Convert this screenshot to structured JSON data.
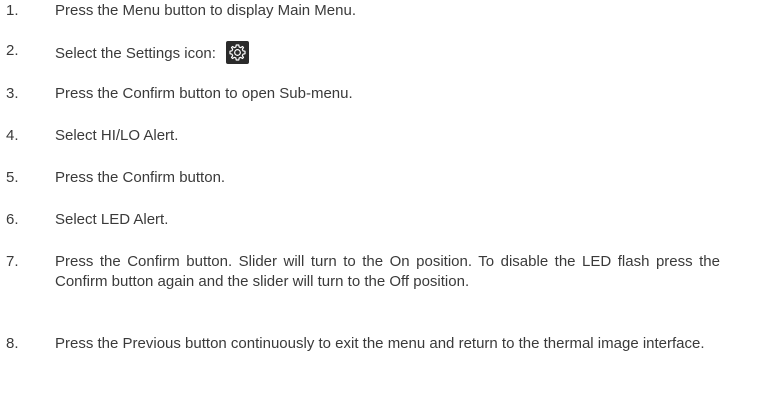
{
  "steps": [
    {
      "number": "1.",
      "text": "Press the Menu button to display Main Menu."
    },
    {
      "number": "2.",
      "text": "Select the Settings icon:",
      "icon": "settings-gear-icon"
    },
    {
      "number": "3.",
      "text": "Press the Confirm button to open Sub-menu."
    },
    {
      "number": "4.",
      "text": "Select HI/LO Alert."
    },
    {
      "number": "5.",
      "text": "Press the Confirm button."
    },
    {
      "number": "6.",
      "text": "Select LED Alert."
    },
    {
      "number": "7.",
      "text": "Press the Confirm button. Slider will turn to the On position. To disable the LED flash press the Confirm button again and the slider will turn to the Off position."
    },
    {
      "number": "8.",
      "text": "Press the Previous button continuously to exit the menu and return to the thermal image interface."
    }
  ],
  "colors": {
    "text": "#3a3a3a",
    "icon_background": "#2b2b2b",
    "icon_foreground": "#ffffff"
  }
}
